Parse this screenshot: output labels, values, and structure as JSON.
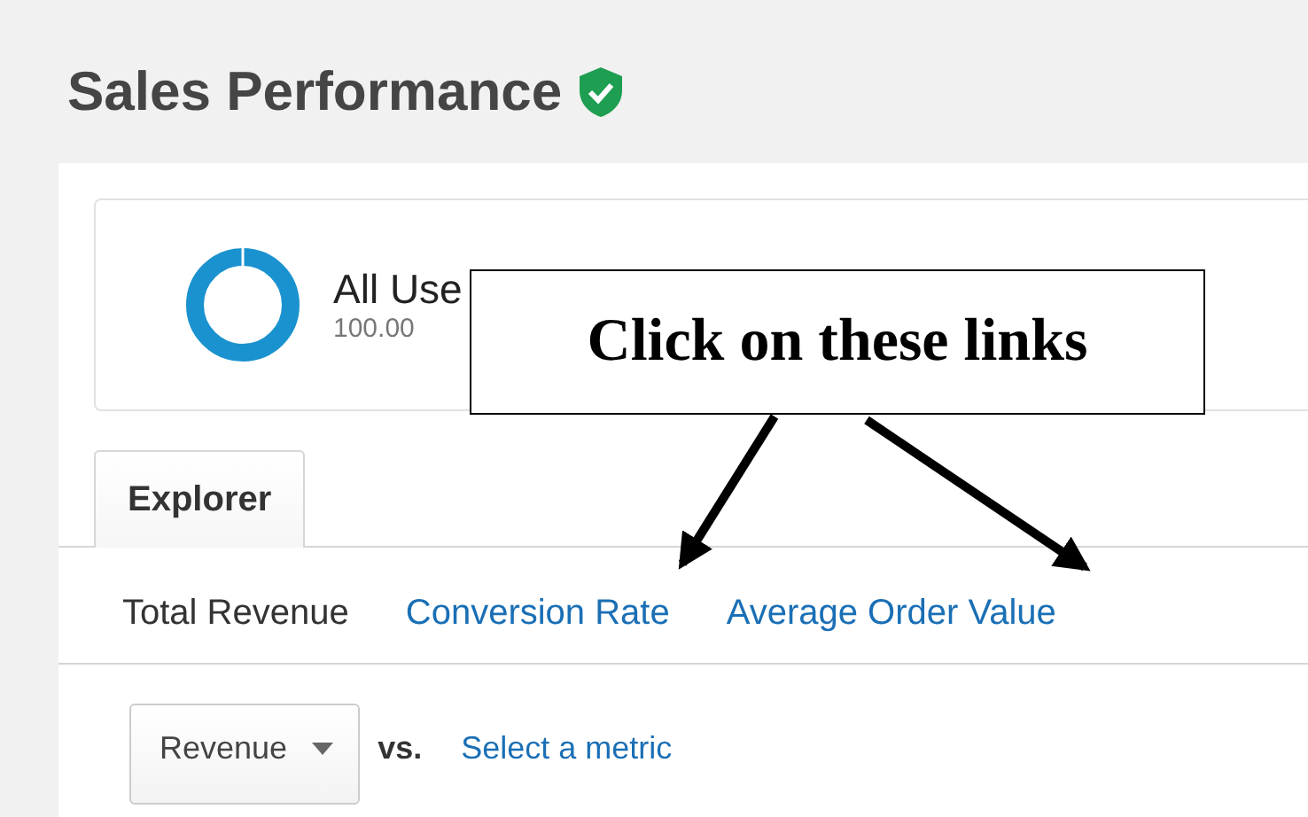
{
  "page": {
    "title": "Sales Performance",
    "verified": true
  },
  "segment": {
    "name": "All Use",
    "share": "100.00"
  },
  "callout": {
    "text": "Click on these links"
  },
  "tabs": [
    {
      "label": "Explorer",
      "selected": true
    }
  ],
  "metrics": [
    {
      "label": "Total Revenue",
      "selected": true
    },
    {
      "label": "Conversion Rate",
      "selected": false
    },
    {
      "label": "Average Order Value",
      "selected": false
    }
  ],
  "controls": {
    "metric_dropdown": "Revenue",
    "vs_label": "vs.",
    "compare_link": "Select a metric"
  }
}
